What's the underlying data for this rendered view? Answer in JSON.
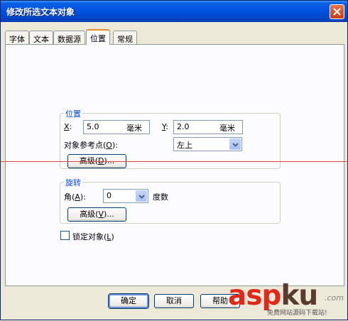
{
  "window": {
    "title": "修改所选文本对象"
  },
  "tabs": [
    {
      "label": "字体",
      "active": false
    },
    {
      "label": "文本",
      "active": false
    },
    {
      "label": "数据源",
      "active": false
    },
    {
      "label": "位置",
      "active": true
    },
    {
      "label": "常规",
      "active": false
    }
  ],
  "position_group": {
    "title": "位置",
    "x_label": "X",
    "x_suffix": ":",
    "x_value": "5.0",
    "x_unit": "毫米",
    "y_label": "Y",
    "y_suffix": ":",
    "y_value": "2.0",
    "y_unit": "毫米",
    "ref_point_label": "对象参考点(",
    "ref_point_key": "O",
    "ref_point_label_end": "):",
    "ref_point_value": "左上",
    "advanced_label": "高级(",
    "advanced_key": "D",
    "advanced_end": ")..."
  },
  "rotation_group": {
    "title": "旋转",
    "angle_label": "角(",
    "angle_key": "A",
    "angle_end": "):",
    "angle_value": "0",
    "angle_unit": "度数",
    "advanced_label": "高级(",
    "advanced_key": "V",
    "advanced_end": ")..."
  },
  "lock": {
    "label": "锁定对象(",
    "key": "L",
    "label_end": ")",
    "checked": false
  },
  "footer": {
    "ok_label": "确定",
    "cancel_label": "取消",
    "help_label": "帮助"
  },
  "watermark": {
    "brand_a": "asp",
    "brand_b": "ku",
    "suffix": ".com",
    "subtitle": "免费网站源码下载站!"
  },
  "colors": {
    "title_bar": "#0054e3",
    "group_title": "#0046d5",
    "active_tab_highlight": "#e68b2c",
    "red_line": "#e04545",
    "watermark_red": "#e0281b"
  }
}
